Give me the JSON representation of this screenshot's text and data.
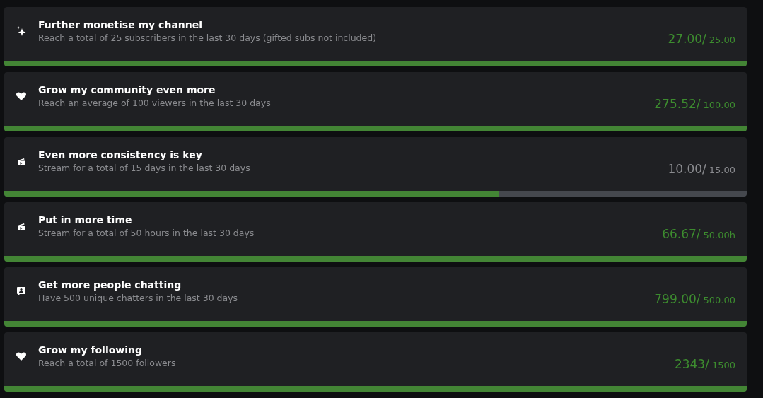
{
  "goals": [
    {
      "kind": "sparkle",
      "title": "Further monetise my channel",
      "description": "Reach a total of 25 subscribers in the last 30 days (gifted subs not included)",
      "current": "27.00/",
      "target": "25.00",
      "completed": true,
      "level": 1
    },
    {
      "kind": "heart",
      "title": "Grow my community even more",
      "description": "Reach an average of 100 viewers in the last 30 days",
      "current": "275.52/",
      "target": "100.00",
      "completed": true,
      "level": 1
    },
    {
      "kind": "camera",
      "title": "Even more consistency is key",
      "description": "Stream for a total of 15 days in the last 30 days",
      "current": "10.00/",
      "target": "15.00",
      "completed": false,
      "level": 0.667
    },
    {
      "kind": "camera",
      "title": "Put in more time",
      "description": "Stream for a total of 50 hours in the last 30 days",
      "current": "66.67/",
      "target": "50.00h",
      "completed": true,
      "level": 1
    },
    {
      "kind": "chat",
      "title": "Get more people chatting",
      "description": "Have 500 unique chatters in the last 30 days",
      "current": "799.00/",
      "target": "500.00",
      "completed": true,
      "level": 1
    },
    {
      "kind": "heart",
      "title": "Grow my following",
      "description": "Reach a total of 1500 followers",
      "current": "2343/",
      "target": "1500",
      "completed": true,
      "level": 1
    }
  ]
}
